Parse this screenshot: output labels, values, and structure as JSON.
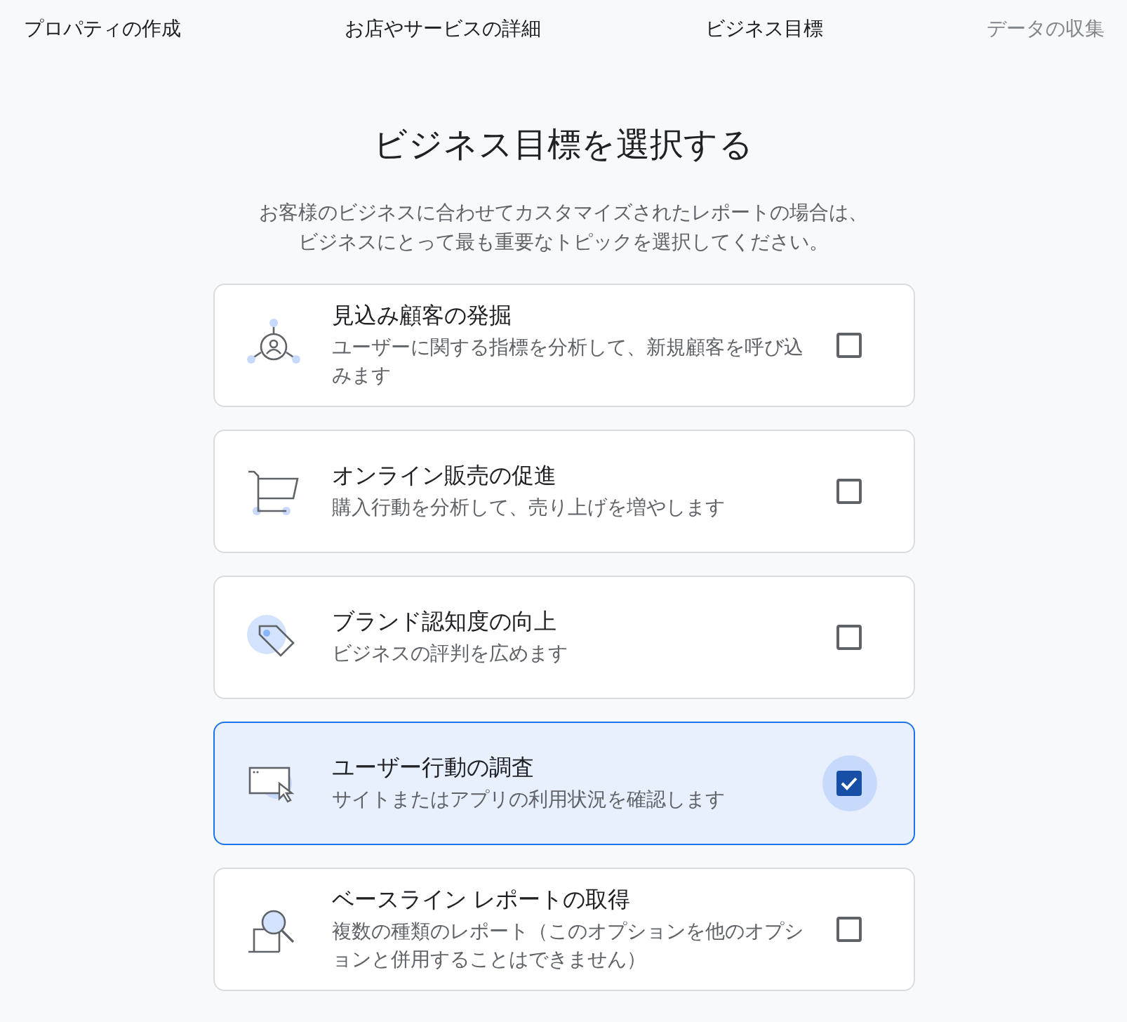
{
  "steps": [
    {
      "label": "プロパティの作成",
      "upcoming": false
    },
    {
      "label": "お店やサービスの詳細",
      "upcoming": false
    },
    {
      "label": "ビジネス目標",
      "upcoming": false
    },
    {
      "label": "データの収集",
      "upcoming": true
    }
  ],
  "heading": "ビジネス目標を選択する",
  "description": "お客様のビジネスに合わせてカスタマイズされたレポートの場合は、ビジネスにとって最も重要なトピックを選択してください。",
  "options": [
    {
      "kind": "target",
      "title": "見込み顧客の発掘",
      "detail": "ユーザーに関する指標を分析して、新規顧客を呼び込みます",
      "checked": false
    },
    {
      "kind": "cart",
      "title": "オンライン販売の促進",
      "detail": "購入行動を分析して、売り上げを増やします",
      "checked": false
    },
    {
      "kind": "tag",
      "title": "ブランド認知度の向上",
      "detail": "ビジネスの評判を広めます",
      "checked": false
    },
    {
      "kind": "window",
      "title": "ユーザー行動の調査",
      "detail": "サイトまたはアプリの利用状況を確認します",
      "checked": true
    },
    {
      "kind": "magnifier",
      "title": "ベースライン レポートの取得",
      "detail": "複数の種類のレポート（このオプションを他のオプションと併用することはできません）",
      "checked": false
    }
  ]
}
